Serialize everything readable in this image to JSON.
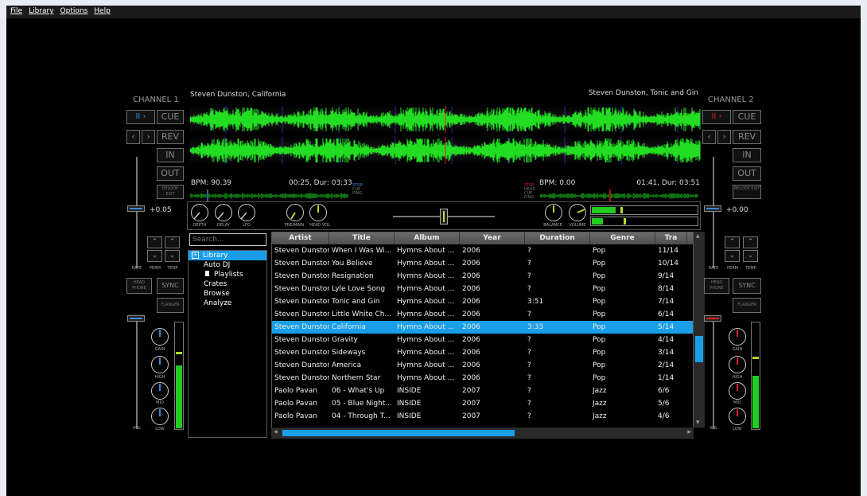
{
  "menu": [
    "File",
    "Library",
    "Options",
    "Help"
  ],
  "channel1": {
    "title": "CHANNEL 1",
    "cue_label": "CUE",
    "rev_label": "REV",
    "in_label": "IN",
    "out_label": "OUT",
    "reloop_label": "RELOOP EXIT",
    "rate_value": "+0.05",
    "rate_label": "RATE",
    "perm_label": "PERM",
    "temp_label": "TEMP",
    "headphone_label": "HEAD PHONE",
    "sync_label": "SYNC",
    "flanger_label": "FLANGER",
    "gain_label": "GAIN",
    "high_label": "HIGH",
    "mid_label": "MID",
    "low_label": "LOW",
    "vol_label": "VOL",
    "track": "Steven Dunston, California",
    "bpm": "BPM: 90.39",
    "time": "00:25, Dur: 03:33",
    "stop_label": "STOP",
    "cue_tag": "CUE",
    "ping_label": "PING",
    "volume_meter": 0.6
  },
  "channel2": {
    "title": "CHANNEL 2",
    "cue_label": "CUE",
    "rev_label": "REV",
    "in_label": "IN",
    "out_label": "OUT",
    "reloop_label": "RELOOP EXIT",
    "rate_value": "+0.00",
    "rate_label": "RATE",
    "perm_label": "PERM",
    "temp_label": "TEMP",
    "headphone_label": "HEAD PHONE",
    "sync_label": "SYNC",
    "flanger_label": "FLANGER",
    "gain_label": "GAIN",
    "high_label": "HIGH",
    "mid_label": "MID",
    "low_label": "LOW",
    "vol_label": "VOL",
    "track": "Steven Dunston, Tonic and Gin",
    "bpm": "BPM: 0.00",
    "time": "01:41, Dur: 03:51",
    "stop_label": "STOP",
    "head_label": "HEAD",
    "cue_tag": "CUE",
    "ping_label": "PING",
    "volume_meter": 0.5
  },
  "mixer": {
    "depth_label": "DEPTH",
    "delay_label": "DELAY",
    "lfo_label": "LFO",
    "premain_label": "PRE/MAIN",
    "headvol_label": "HEAD VOL",
    "balance_label": "BALANCE",
    "volume_label": "VOLUME",
    "crossfader": 0.5
  },
  "colors": {
    "wave": "#22dd22",
    "selection": "#1a9ee8",
    "play_blue": "#3a88d8",
    "play_red": "#e02020"
  },
  "library": {
    "search_placeholder": "Search...",
    "tree": [
      "Library",
      "Auto DJ",
      "Playlists",
      "Crates",
      "Browse",
      "Analyze"
    ],
    "columns": [
      "Artist",
      "Title",
      "Album",
      "Year",
      "Duration",
      "Genre",
      "Tra"
    ],
    "rows": [
      [
        "Steven Dunston",
        "When I Was Wi...",
        "Hymns About ...",
        "2006",
        "?",
        "Pop",
        "11/14"
      ],
      [
        "Steven Dunston",
        "You Believe",
        "Hymns About ...",
        "2006",
        "?",
        "Pop",
        "10/14"
      ],
      [
        "Steven Dunston",
        "Resignation",
        "Hymns About ...",
        "2006",
        "?",
        "Pop",
        "9/14"
      ],
      [
        "Steven Dunston",
        "Lyle Love Song",
        "Hymns About ...",
        "2006",
        "?",
        "Pop",
        "8/14"
      ],
      [
        "Steven Dunston",
        "Tonic and Gin",
        "Hymns About ...",
        "2006",
        "3:51",
        "Pop",
        "7/14"
      ],
      [
        "Steven Dunston",
        "Little White Ch...",
        "Hymns About ...",
        "2006",
        "?",
        "Pop",
        "6/14"
      ],
      [
        "Steven Dunston",
        "California",
        "Hymns About ...",
        "2006",
        "3:33",
        "Pop",
        "5/14"
      ],
      [
        "Steven Dunston",
        "Gravity",
        "Hymns About ...",
        "2006",
        "?",
        "Pop",
        "4/14"
      ],
      [
        "Steven Dunston",
        "Sideways",
        "Hymns About ...",
        "2006",
        "?",
        "Pop",
        "3/14"
      ],
      [
        "Steven Dunston",
        "America",
        "Hymns About ...",
        "2006",
        "?",
        "Pop",
        "2/14"
      ],
      [
        "Steven Dunston",
        "Northern Star",
        "Hymns About ...",
        "2006",
        "?",
        "Pop",
        "1/14"
      ],
      [
        "Paolo Pavan",
        "06 - What's Up",
        "INSIDE",
        "2007",
        "?",
        "Jazz",
        "6/6"
      ],
      [
        "Paolo Pavan",
        "05 - Blue Night...",
        "INSIDE",
        "2007",
        "?",
        "Jazz",
        "5/6"
      ],
      [
        "Paolo Pavan",
        "04 - Through T...",
        "INSIDE",
        "2007",
        "?",
        "Jazz",
        "4/6"
      ]
    ],
    "selected_row": 6
  }
}
